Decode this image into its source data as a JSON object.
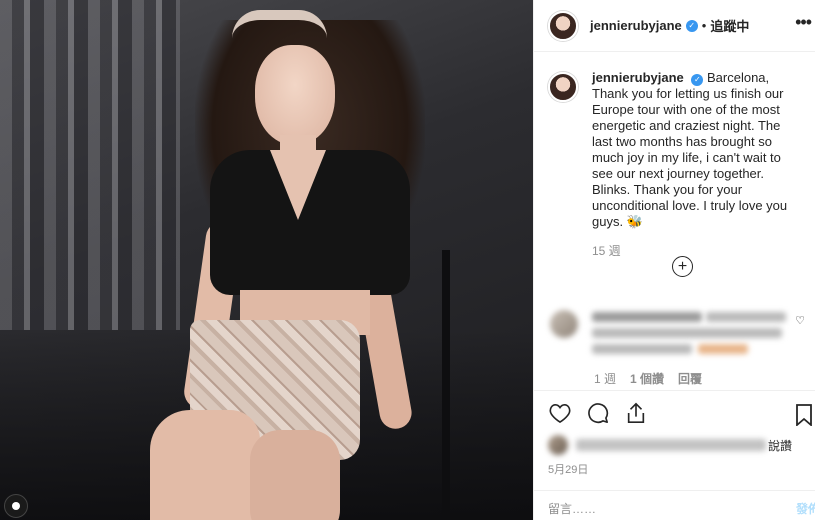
{
  "post": {
    "username": "jennierubyjane",
    "follow_label": "追蹤中",
    "separator": "•",
    "more_label": "•••",
    "caption": "Barcelona, Thank you for letting us finish our Europe tour with one of the most energetic and craziest night. The last two months has brought so much joy in my life, i can't wait to see our next journey together. Blinks. Thank you for your unconditional love. I truly love you guys. 🐝",
    "caption_age": "15 週",
    "load_more_label": "+"
  },
  "comment": {
    "age": "1 週",
    "likes": "1 個讚",
    "reply_label": "回覆"
  },
  "actions": {
    "like_icon": "heart-icon",
    "comment_icon": "comment-icon",
    "share_icon": "share-icon",
    "save_icon": "bookmark-icon",
    "likes_tail": "說讚",
    "date": "5月29日"
  },
  "add_comment": {
    "placeholder": "留言……",
    "post_label": "發佈"
  },
  "colors": {
    "accent": "#3897f0",
    "muted": "#8e8e8e",
    "text": "#262626"
  }
}
